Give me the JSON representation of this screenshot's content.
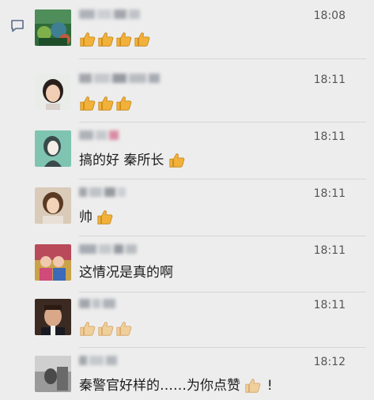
{
  "comments": [
    {
      "time": "18:08",
      "text": "",
      "thumbs": 4,
      "thumb_style": "color"
    },
    {
      "time": "18:11",
      "text": "",
      "thumbs": 3,
      "thumb_style": "color"
    },
    {
      "time": "18:11",
      "text": "搞的好  秦所长",
      "thumbs": 1,
      "thumb_style": "color"
    },
    {
      "time": "18:11",
      "text": "帅",
      "thumbs": 1,
      "thumb_style": "color"
    },
    {
      "time": "18:11",
      "text": "这情况是真的啊",
      "thumbs": 0,
      "thumb_style": "color"
    },
    {
      "time": "18:11",
      "text": "",
      "thumbs": 3,
      "thumb_style": "pale"
    },
    {
      "time": "18:12",
      "text": "秦警官好样的……为你点赞",
      "thumbs": 1,
      "thumb_style": "pale",
      "suffix": "!"
    }
  ],
  "icons": {
    "comment": "comment-icon",
    "thumb": "thumbs-up-icon"
  },
  "colors": {
    "background": "#ededed",
    "divider": "#d6d6d6",
    "thumb_color": "#f2b23a",
    "thumb_pale": "#efcf9c"
  }
}
